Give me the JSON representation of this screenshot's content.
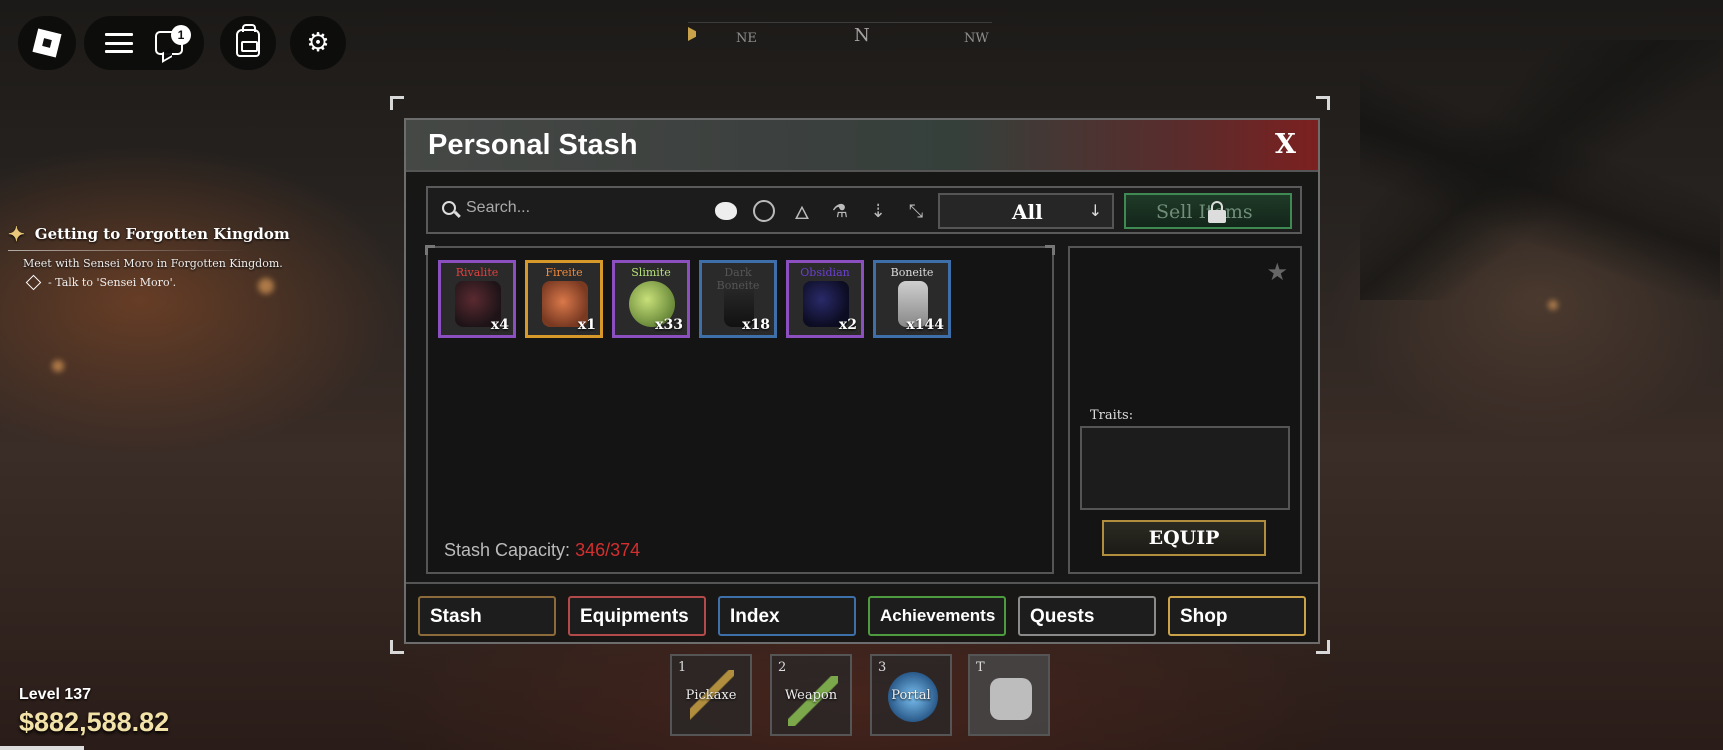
{
  "hud": {
    "chat_badge": "1",
    "compass": {
      "ne": "NE",
      "n": "N",
      "nw": "NW"
    },
    "level": "Level 137",
    "money": "$882,588.82"
  },
  "quest": {
    "title": "Getting to Forgotten Kingdom",
    "description": "Meet with Sensei Moro in Forgotten Kingdom.",
    "objective": "- Talk to 'Sensei Moro'."
  },
  "stash": {
    "title": "Personal Stash",
    "close_label": "X",
    "search_placeholder": "Search...",
    "filter_value": "All",
    "sell_label": "Sell Items",
    "capacity_label": "Stash Capacity:",
    "capacity_value": "346/374",
    "items": [
      {
        "name": "Rivalite",
        "qty": "x4",
        "name_color": "#e04040",
        "border": "#8b4fc0"
      },
      {
        "name": "Fireite",
        "qty": "x1",
        "name_color": "#f08a3a",
        "border": "#d79a2a"
      },
      {
        "name": "Slimite",
        "qty": "x33",
        "name_color": "#b6e07a",
        "border": "#8b4fc0"
      },
      {
        "name": "Dark Boneite",
        "qty": "x18",
        "name_color": "#555555",
        "border": "#3f6fa8"
      },
      {
        "name": "Obsidian",
        "qty": "x2",
        "name_color": "#6a3fd0",
        "border": "#8b4fc0"
      },
      {
        "name": "Boneite",
        "qty": "x144",
        "name_color": "#dddddd",
        "border": "#3f6fa8"
      }
    ],
    "traits_label": "Traits:",
    "equip_label": "EQUIP",
    "tabs": [
      {
        "label": "Stash",
        "color": "#8c6a3a"
      },
      {
        "label": "Equipments",
        "color": "#b24a4a"
      },
      {
        "label": "Index",
        "color": "#3d6fa8"
      },
      {
        "label": "Achievements",
        "color": "#4e9a3e"
      },
      {
        "label": "Quests",
        "color": "#8a8a8a"
      },
      {
        "label": "Shop",
        "color": "#c9a24a"
      }
    ]
  },
  "hotbar": [
    {
      "key": "1",
      "label": "Pickaxe"
    },
    {
      "key": "2",
      "label": "Weapon"
    },
    {
      "key": "3",
      "label": "Portal"
    },
    {
      "key": "T",
      "label": ""
    }
  ]
}
